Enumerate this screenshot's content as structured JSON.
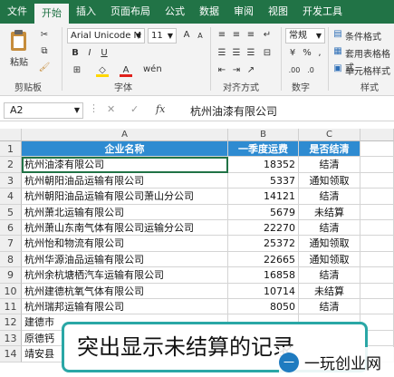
{
  "tabs": [
    "文件",
    "开始",
    "插入",
    "页面布局",
    "公式",
    "数据",
    "审阅",
    "视图",
    "开发工具"
  ],
  "ribbon": {
    "clipboard_label": "剪贴板",
    "paste_label": "粘贴",
    "font_label": "字体",
    "align_label": "对齐方式",
    "number_label": "数字",
    "styles_label": "样式",
    "font_name": "Arial Unicode M",
    "font_size": "11",
    "number_format": "常规",
    "bold": "B",
    "italic": "I",
    "underline": "U",
    "cond_format": "条件格式",
    "table_format": "套用表格格式",
    "cell_style": "单元格样式",
    "wen": "wén",
    "percent": "%",
    "comma": ","
  },
  "formula_bar": {
    "name_box": "A2",
    "fx": "fx",
    "content": "杭州油漆有限公司"
  },
  "columns": [
    "A",
    "B",
    "C"
  ],
  "rows": [
    {
      "n": "1",
      "a": "企业名称",
      "b": "一季度运费",
      "c": "是否结清",
      "header": true
    },
    {
      "n": "2",
      "a": "杭州油漆有限公司",
      "b": "18352",
      "c": "结清"
    },
    {
      "n": "3",
      "a": "杭州朝阳油品运输有限公司",
      "b": "5337",
      "c": "通知领取"
    },
    {
      "n": "4",
      "a": "杭州朝阳油品运输有限公司萧山分公司",
      "b": "14121",
      "c": "结清"
    },
    {
      "n": "5",
      "a": "杭州萧北运输有限公司",
      "b": "5679",
      "c": "未结算"
    },
    {
      "n": "6",
      "a": "杭州萧山东南气体有限公司运输分公司",
      "b": "22270",
      "c": "结清"
    },
    {
      "n": "7",
      "a": "杭州怡和物流有限公司",
      "b": "25372",
      "c": "通知领取"
    },
    {
      "n": "8",
      "a": "杭州华源油品运输有限公司",
      "b": "22665",
      "c": "通知领取"
    },
    {
      "n": "9",
      "a": "杭州余杭塘栖汽车运输有限公司",
      "b": "16858",
      "c": "结清"
    },
    {
      "n": "10",
      "a": "杭州建德杭氧气体有限公司",
      "b": "10714",
      "c": "未结算"
    },
    {
      "n": "11",
      "a": "杭州瑞邦运输有限公司",
      "b": "8050",
      "c": "结清"
    },
    {
      "n": "12",
      "a": "建德市",
      "b": "",
      "c": ""
    },
    {
      "n": "13",
      "a": "原德钙",
      "b": "",
      "c": ""
    },
    {
      "n": "14",
      "a": "靖安县",
      "b": "",
      "c": ""
    }
  ],
  "caption": "突出显示未结算的记录",
  "watermark": {
    "logo": "一",
    "text": "一玩创业网"
  },
  "colors": {
    "ribbon_green": "#217346",
    "header_blue": "#2e8bd1",
    "caption_border": "#2aa7a6"
  }
}
